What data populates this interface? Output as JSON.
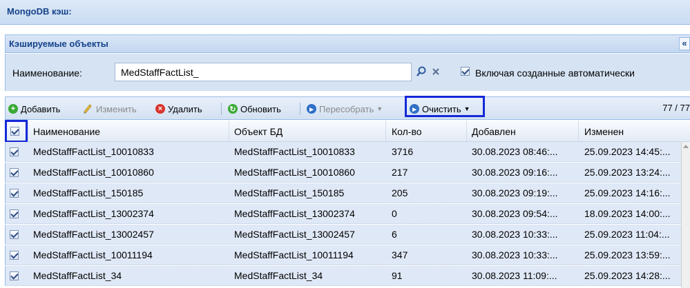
{
  "panel": {
    "title": "MongoDB кэш:"
  },
  "subpanel": {
    "title": "Кэшируемые объекты",
    "collapse_icon": "«"
  },
  "filter": {
    "label": "Наименование:",
    "value": "MedStaffFactList_",
    "auto_label": "Включая созданные автоматически",
    "auto_checked": true
  },
  "toolbar": {
    "add": "Добавить",
    "edit": "Изменить",
    "delete": "Удалить",
    "refresh": "Обновить",
    "rebuild": "Пересобрать",
    "clear": "Очистить",
    "counter": "77 / 77"
  },
  "grid": {
    "columns": [
      "Наименование",
      "Объект БД",
      "Кол-во",
      "Добавлен",
      "Изменен"
    ],
    "rows": [
      [
        "MedStaffFactList_10010833",
        "MedStaffFactList_10010833",
        "3716",
        "30.08.2023 08:46:...",
        "25.09.2023 14:45:..."
      ],
      [
        "MedStaffFactList_10010860",
        "MedStaffFactList_10010860",
        "217",
        "30.08.2023 09:16:...",
        "25.09.2023 13:24:..."
      ],
      [
        "MedStaffFactList_150185",
        "MedStaffFactList_150185",
        "205",
        "30.08.2023 09:19:...",
        "25.09.2023 14:16:..."
      ],
      [
        "MedStaffFactList_13002374",
        "MedStaffFactList_13002374",
        "0",
        "30.08.2023 09:54:...",
        "18.09.2023 14:00:..."
      ],
      [
        "MedStaffFactList_13002457",
        "MedStaffFactList_13002457",
        "6",
        "30.08.2023 10:33:...",
        "25.09.2023 11:04:..."
      ],
      [
        "MedStaffFactList_10011194",
        "MedStaffFactList_10011194",
        "347",
        "30.08.2023 10:33:...",
        "25.09.2023 13:59:..."
      ],
      [
        "MedStaffFactList_34",
        "MedStaffFactList_34",
        "91",
        "30.08.2023 11:09:...",
        "25.09.2023 14:28:..."
      ]
    ]
  }
}
